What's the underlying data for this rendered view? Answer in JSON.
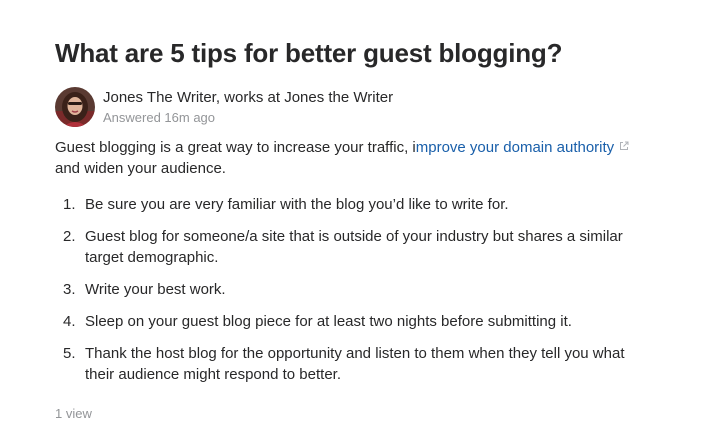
{
  "question": {
    "title": "What are 5 tips for better guest blogging?"
  },
  "author": {
    "name": "Jones The Writer",
    "credential": ", works at Jones the Writer",
    "answered": "Answered 16m ago"
  },
  "answer": {
    "intro_before_link": "Guest blogging is a great way to increase your traffic, i",
    "link_text": "mprove your domain authority",
    "intro_after_link": "and widen your audience.",
    "tips": [
      {
        "num": "1.",
        "text": "Be sure you are very familiar with the blog you’d like to write for."
      },
      {
        "num": "2.",
        "text": "Guest blog for someone/a site that is outside of your industry but shares a similar target demographic."
      },
      {
        "num": "3.",
        "text": "Write your best work."
      },
      {
        "num": "4.",
        "text": "Sleep on your guest blog piece for at least two nights before submitting it."
      },
      {
        "num": "5.",
        "text": "Thank the host blog for the opportunity and listen to them when they tell you what their audience might respond to better."
      }
    ]
  },
  "stats": {
    "views": "1 view"
  },
  "colors": {
    "link": "#195faa",
    "muted": "#939598",
    "text": "#282829"
  }
}
